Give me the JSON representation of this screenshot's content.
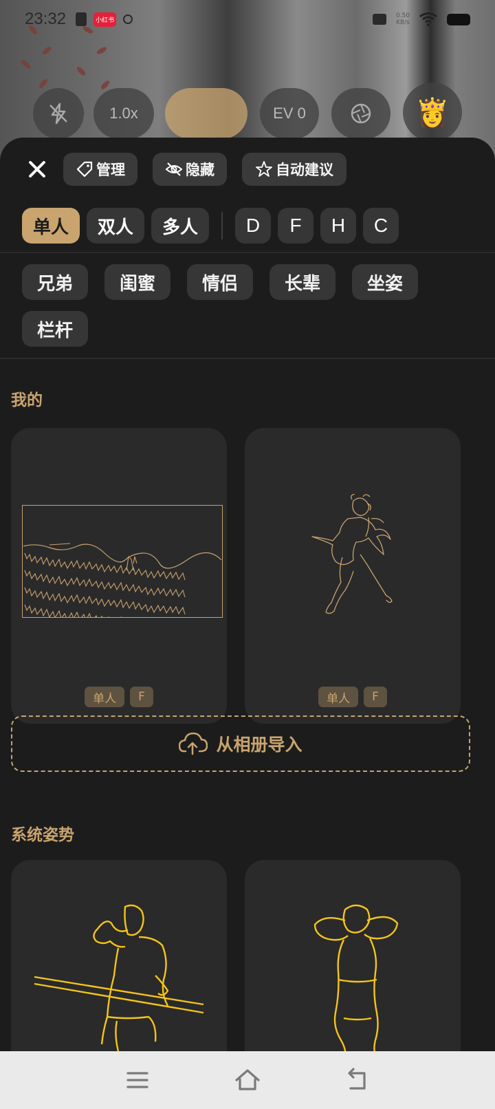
{
  "status_bar": {
    "time": "23:32",
    "app_badge": "小红书",
    "net_speed_value": "0.50",
    "net_speed_unit": "KB/s"
  },
  "camera_controls": {
    "flash_icon": "flash-off-icon",
    "zoom_label": "1.0x",
    "ev_label": "EV 0",
    "aperture_icon": "aperture-icon",
    "avatar_emoji": "👸"
  },
  "toolbar": {
    "close_icon": "close-icon",
    "manage_label": "管理",
    "hide_label": "隐藏",
    "auto_suggest_label": "自动建议"
  },
  "categories": {
    "primary": [
      "单人",
      "双人",
      "多人"
    ],
    "selected": "单人",
    "letters": [
      "D",
      "F",
      "H",
      "C"
    ]
  },
  "subcategories": [
    "兄弟",
    "闺蜜",
    "情侣",
    "长辈",
    "坐姿",
    "栏杆"
  ],
  "my_section": {
    "title": "我的",
    "cards": [
      {
        "tags": [
          "单人",
          "F"
        ]
      },
      {
        "tags": [
          "单人",
          "F"
        ]
      }
    ]
  },
  "import_label": "从相册导入",
  "system_section": {
    "title": "系统姿势"
  },
  "colors": {
    "accent": "#c9a46f",
    "pose_line": "#f5c518",
    "sheet_bg": "#1c1c1c",
    "card_bg": "#2a2a2a",
    "chip_bg": "#363636"
  },
  "nav_bar": {
    "menu_icon": "menu-icon",
    "home_icon": "home-icon",
    "back_icon": "back-icon"
  }
}
